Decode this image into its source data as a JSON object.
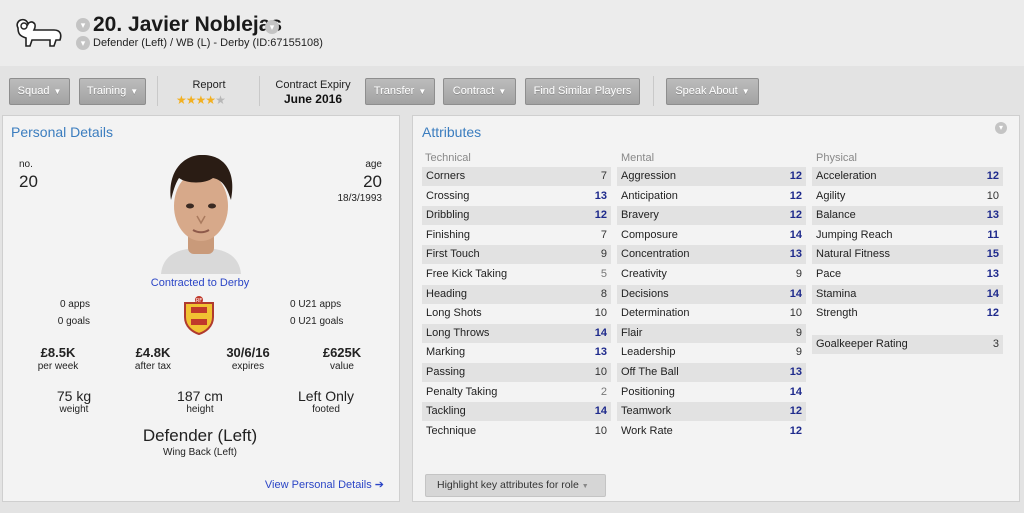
{
  "header": {
    "player_title": "20. Javier Noblejas",
    "subtitle": "Defender (Left) / WB (L) - Derby (ID:67155108)"
  },
  "toolbar": {
    "squad": "Squad",
    "training": "Training",
    "report_label": "Report",
    "report_stars": 4,
    "report_stars_max": 5,
    "contract_expiry_label": "Contract Expiry",
    "contract_expiry_value": "June 2016",
    "transfer": "Transfer",
    "contract": "Contract",
    "find_similar": "Find Similar Players",
    "speak_about": "Speak About"
  },
  "personal": {
    "title": "Personal Details",
    "no_label": "no.",
    "no_value": "20",
    "age_label": "age",
    "age_value": "20",
    "dob": "18/3/1993",
    "contracted": "Contracted to Derby",
    "apps": "0 apps",
    "goals": "0 goals",
    "u21_apps": "0 U21 apps",
    "u21_goals": "0 U21 goals",
    "wage": "£8.5K",
    "wage_label": "per week",
    "after_tax": "£4.8K",
    "after_tax_label": "after tax",
    "expires": "30/6/16",
    "expires_label": "expires",
    "value": "£625K",
    "value_label": "value",
    "weight": "75 kg",
    "weight_label": "weight",
    "height": "187 cm",
    "height_label": "height",
    "foot": "Left Only",
    "foot_label": "footed",
    "position": "Defender (Left)",
    "role": "Wing Back (Left)",
    "view_link": "View Personal Details"
  },
  "attributes": {
    "title": "Attributes",
    "technical_head": "Technical",
    "mental_head": "Mental",
    "physical_head": "Physical",
    "technical": [
      {
        "name": "Corners",
        "value": "7"
      },
      {
        "name": "Crossing",
        "value": "13"
      },
      {
        "name": "Dribbling",
        "value": "12"
      },
      {
        "name": "Finishing",
        "value": "7"
      },
      {
        "name": "First Touch",
        "value": "9"
      },
      {
        "name": "Free Kick Taking",
        "value": "5"
      },
      {
        "name": "Heading",
        "value": "8"
      },
      {
        "name": "Long Shots",
        "value": "10"
      },
      {
        "name": "Long Throws",
        "value": "14"
      },
      {
        "name": "Marking",
        "value": "13"
      },
      {
        "name": "Passing",
        "value": "10"
      },
      {
        "name": "Penalty Taking",
        "value": "2"
      },
      {
        "name": "Tackling",
        "value": "14"
      },
      {
        "name": "Technique",
        "value": "10"
      }
    ],
    "mental": [
      {
        "name": "Aggression",
        "value": "12"
      },
      {
        "name": "Anticipation",
        "value": "12"
      },
      {
        "name": "Bravery",
        "value": "12"
      },
      {
        "name": "Composure",
        "value": "14"
      },
      {
        "name": "Concentration",
        "value": "13"
      },
      {
        "name": "Creativity",
        "value": "9"
      },
      {
        "name": "Decisions",
        "value": "14"
      },
      {
        "name": "Determination",
        "value": "10"
      },
      {
        "name": "Flair",
        "value": "9"
      },
      {
        "name": "Leadership",
        "value": "9"
      },
      {
        "name": "Off The Ball",
        "value": "13"
      },
      {
        "name": "Positioning",
        "value": "14"
      },
      {
        "name": "Teamwork",
        "value": "12"
      },
      {
        "name": "Work Rate",
        "value": "12"
      }
    ],
    "physical": [
      {
        "name": "Acceleration",
        "value": "12"
      },
      {
        "name": "Agility",
        "value": "10"
      },
      {
        "name": "Balance",
        "value": "13"
      },
      {
        "name": "Jumping Reach",
        "value": "11"
      },
      {
        "name": "Natural Fitness",
        "value": "15"
      },
      {
        "name": "Pace",
        "value": "13"
      },
      {
        "name": "Stamina",
        "value": "14"
      },
      {
        "name": "Strength",
        "value": "12"
      }
    ],
    "goalkeeper_rating": {
      "name": "Goalkeeper Rating",
      "value": "3"
    },
    "highlight_button": "Highlight key attributes for role"
  },
  "colors": {
    "accent_blue": "#3b7dbf",
    "strong_value": "#1e2a8c",
    "button_grey": "#a9a9a9"
  }
}
